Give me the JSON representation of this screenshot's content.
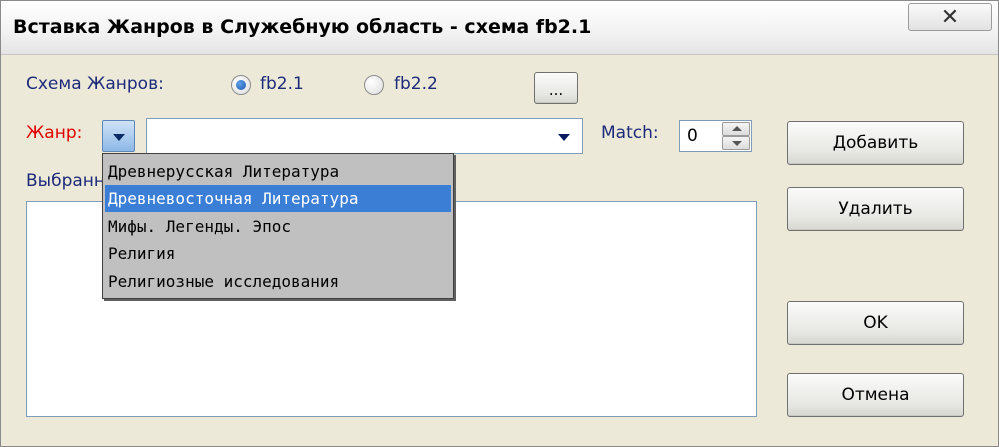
{
  "window": {
    "title": "Вставка Жанров в Служебную область - схема fb2.1",
    "close_glyph": "✕"
  },
  "schema": {
    "label": "Схема Жанров:",
    "options": [
      {
        "label": "fb2.1",
        "selected": true
      },
      {
        "label": "fb2.2",
        "selected": false
      }
    ],
    "browse_label": "..."
  },
  "genre": {
    "label": "Жанр:",
    "value": "",
    "dropdown_items": [
      "Древнерусская Литература",
      "Древневосточная Литература",
      "Мифы. Легенды. Эпос",
      "Религия",
      "Религиозные исследования"
    ],
    "highlighted_index": 1
  },
  "match": {
    "label": "Match:",
    "value": "0"
  },
  "selected_list": {
    "label": "Выбранн"
  },
  "buttons": {
    "add": "Добавить",
    "remove": "Удалить",
    "ok": "OK",
    "cancel": "Отмена"
  },
  "colors": {
    "label_blue": "#1c2a7a",
    "label_red": "#e00000",
    "highlight": "#3a7ed6"
  }
}
